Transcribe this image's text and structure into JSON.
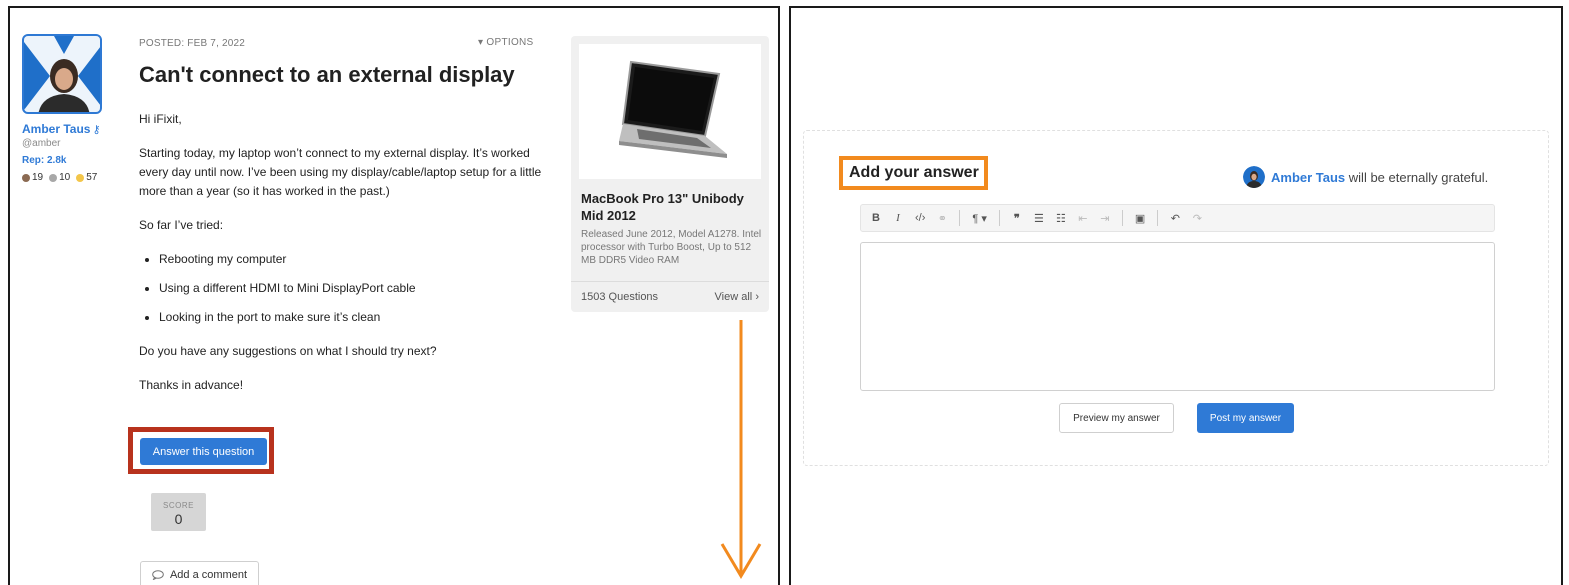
{
  "question": {
    "posted": "POSTED: FEB 7, 2022",
    "options_label": "OPTIONS",
    "title": "Can't connect to an external display",
    "greeting": "Hi iFixit,",
    "paragraph1": "Starting today, my laptop won’t connect to my external display. It’s worked every day until now. I’ve been using my display/cable/laptop setup for a little more than a year (so it has worked in the past.)",
    "paragraph2": "So far I’ve tried:",
    "tried": [
      "Rebooting my computer",
      "Using a different HDMI to Mini DisplayPort cable",
      "Looking in the port to make sure it’s clean"
    ],
    "paragraph3": "Do you have any suggestions on what I should try next?",
    "closing": "Thanks in advance!",
    "answer_button": "Answer this question",
    "score_label": "SCORE",
    "score_value": "0",
    "comment_button": "Add a comment"
  },
  "author": {
    "name": "Amber Taus",
    "handle": "@amber",
    "rep": "Rep: 2.8k",
    "badges": [
      {
        "count": "19",
        "color": "#8b6a52"
      },
      {
        "count": "10",
        "color": "#a8a8a8"
      },
      {
        "count": "57",
        "color": "#f3c64a"
      }
    ]
  },
  "device": {
    "name": "MacBook Pro 13\" Unibody Mid 2012",
    "description": "Released June 2012, Model A1278. Intel processor with Turbo Boost, Up to 512 MB DDR5 Video RAM",
    "questions_count": "1503 Questions",
    "view_all": "View all"
  },
  "answer_form": {
    "title": "Add your answer",
    "grateful_name": "Amber Taus",
    "grateful_suffix": " will be eternally grateful.",
    "toolbar": [
      {
        "glyph": "B",
        "icon": "bold-icon",
        "dim": false
      },
      {
        "glyph": "I",
        "icon": "italic-icon",
        "dim": false
      },
      {
        "glyph": "‹/›",
        "icon": "code-icon",
        "dim": false
      },
      {
        "glyph": "⚭",
        "icon": "link-icon",
        "dim": true
      },
      {
        "sep": true
      },
      {
        "glyph": "¶ ▾",
        "icon": "paragraph-icon",
        "dim": false
      },
      {
        "sep": true
      },
      {
        "glyph": "❞",
        "icon": "quote-icon",
        "dim": false
      },
      {
        "glyph": "☰",
        "icon": "bullet-list-icon",
        "dim": false
      },
      {
        "glyph": "☷",
        "icon": "numbered-list-icon",
        "dim": false
      },
      {
        "glyph": "⇤",
        "icon": "outdent-icon",
        "dim": true
      },
      {
        "glyph": "⇥",
        "icon": "indent-icon",
        "dim": true
      },
      {
        "sep": true
      },
      {
        "glyph": "▣",
        "icon": "image-icon",
        "dim": false
      },
      {
        "sep": true
      },
      {
        "glyph": "↶",
        "icon": "undo-icon",
        "dim": false
      },
      {
        "glyph": "↷",
        "icon": "redo-icon",
        "dim": true
      }
    ],
    "preview_button": "Preview my answer",
    "post_button": "Post my answer"
  },
  "colors": {
    "accent": "#2f7ad6",
    "highlight_red": "#b8321d",
    "highlight_orange": "#f28a1e"
  }
}
